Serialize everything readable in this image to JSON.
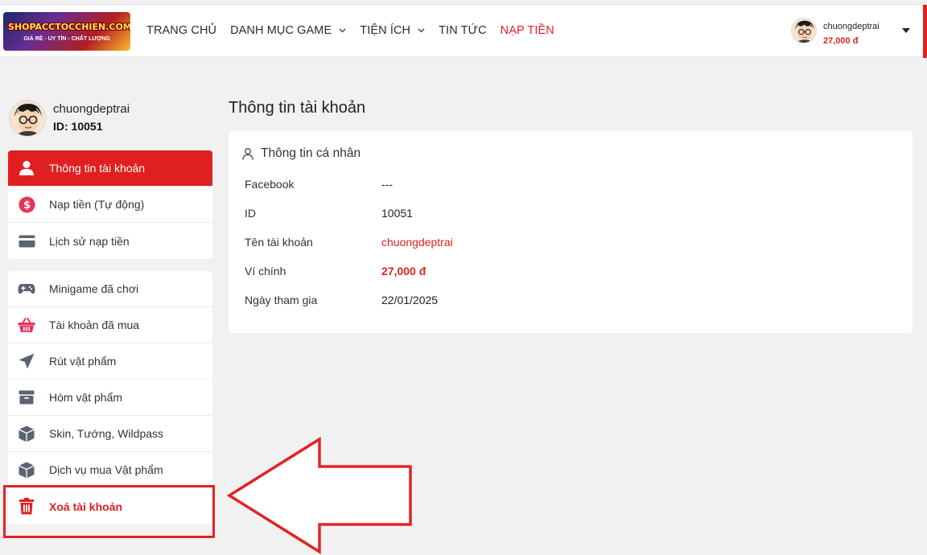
{
  "header": {
    "logo_text": "SHOPACCTOCCHIEN.COM",
    "logo_tagline": "GIÁ RẺ - UY TÍN - CHẤT LƯỢNG",
    "nav": [
      {
        "label": "TRANG CHỦ",
        "has_dropdown": false,
        "active": false
      },
      {
        "label": "DANH MỤC GAME",
        "has_dropdown": true,
        "active": false
      },
      {
        "label": "TIỆN ÍCH",
        "has_dropdown": true,
        "active": false
      },
      {
        "label": "TIN TỨC",
        "has_dropdown": false,
        "active": false
      },
      {
        "label": "NẠP TIỀN",
        "has_dropdown": false,
        "active": true
      }
    ],
    "user": {
      "name": "chuongdeptrai",
      "balance": "27,000 đ",
      "avatar_icon": "avatar-icon"
    }
  },
  "sidebar": {
    "profile": {
      "name": "chuongdeptrai",
      "id_text": "ID: 10051"
    },
    "group1": [
      {
        "label": "Thông tin tài khoản",
        "icon": "user-icon",
        "active": true
      },
      {
        "label": "Nạp tiền (Tự động)",
        "icon": "dollar-circle-icon",
        "active": false
      },
      {
        "label": "Lịch sử nạp tiền",
        "icon": "credit-card-icon",
        "active": false
      }
    ],
    "group2": [
      {
        "label": "Minigame đã chơi",
        "icon": "gamepad-icon"
      },
      {
        "label": "Tài khoản đã mua",
        "icon": "basket-icon"
      },
      {
        "label": "Rút vật phẩm",
        "icon": "paper-plane-icon"
      },
      {
        "label": "Hòm vật phẩm",
        "icon": "archive-box-icon"
      },
      {
        "label": "Skin, Tướng, Wildpass",
        "icon": "cube-icon"
      },
      {
        "label": "Dịch vụ mua Vật phẩm",
        "icon": "cube-icon"
      },
      {
        "label": "Xoá tài khoản",
        "icon": "trash-icon",
        "danger": true
      }
    ]
  },
  "main": {
    "title": "Thông tin tài khoản",
    "card_title": "Thông tin cá nhân",
    "rows": [
      {
        "label": "Facebook",
        "value": "---"
      },
      {
        "label": "ID",
        "value": "10051"
      },
      {
        "label": "Tên tài khoản",
        "value": "chuongdeptrai"
      },
      {
        "label": "Ví chính",
        "value": "27,000 đ"
      },
      {
        "label": "Ngày tham gia",
        "value": "22/01/2025"
      }
    ]
  },
  "colors": {
    "accent": "#e02020",
    "background": "#f1f1f1",
    "card": "#ffffff",
    "annotation": "#e02525"
  }
}
